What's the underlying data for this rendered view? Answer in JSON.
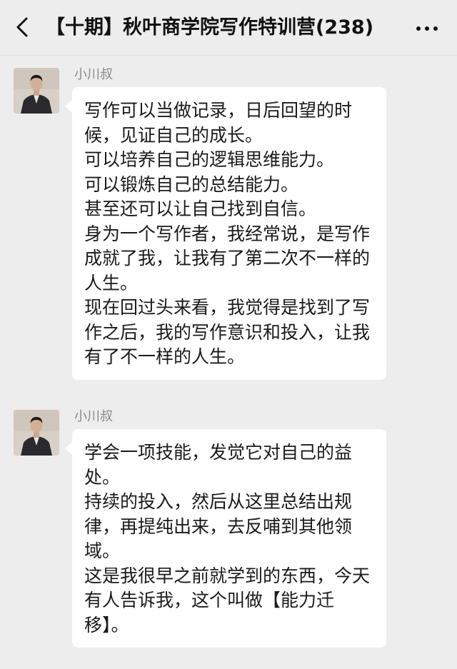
{
  "header": {
    "title": "【十期】秋叶商学院写作特训营(238)",
    "back_icon": "chevron-left-icon",
    "more_icon": "more-dots-icon"
  },
  "messages": [
    {
      "sender": "小川叔",
      "text": "写作可以当做记录，日后回望的时候，见证自己的成长。\n可以培养自己的逻辑思维能力。\n可以锻炼自己的总结能力。\n甚至还可以让自己找到自信。\n身为一个写作者，我经常说，是写作成就了我，让我有了第二次不一样的人生。\n现在回过头来看，我觉得是找到了写作之后，我的写作意识和投入，让我有了不一样的人生。"
    },
    {
      "sender": "小川叔",
      "text": "学会一项技能，发觉它对自己的益处。\n持续的投入，然后从这里总结出规律，再提纯出来，去反哺到其他领域。\n这是我很早之前就学到的东西，今天有人告诉我，这个叫做【能力迁移】。"
    }
  ],
  "colors": {
    "background": "#ededed",
    "bubble": "#ffffff",
    "sender": "#8a8a8a",
    "text": "#1a1a1a"
  }
}
